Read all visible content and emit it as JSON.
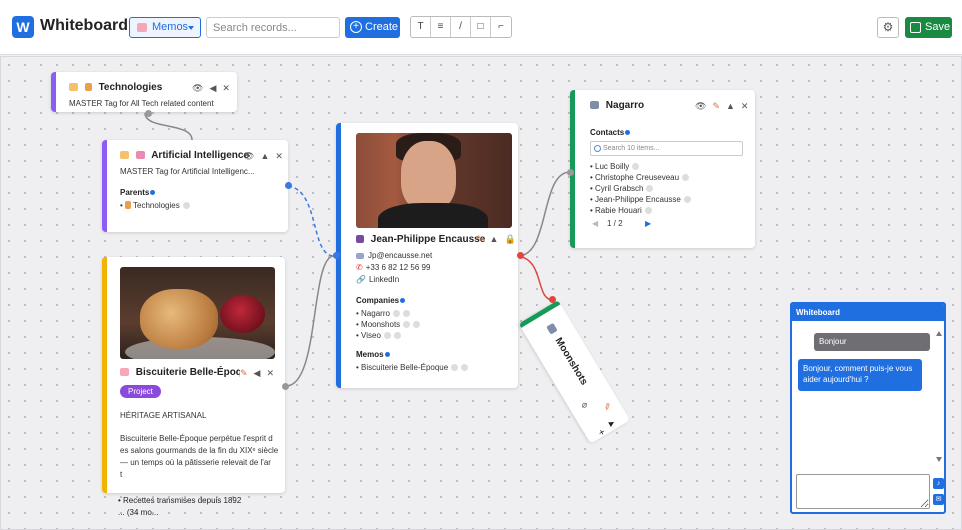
{
  "app": {
    "logo_letter": "W",
    "title": "Whiteboard"
  },
  "toolbar": {
    "memos_select": "Memos",
    "search_placeholder": "Search records...",
    "create_label": "Create",
    "tools": [
      "T",
      "≡",
      "/",
      "□",
      "⌐"
    ],
    "save_label": "Save"
  },
  "cards": {
    "technologies": {
      "title": "Technologies",
      "description": "MASTER Tag for All Tech related content",
      "color": "#8b5cf6"
    },
    "ai": {
      "title": "Artificial Intelligence",
      "description": "MASTER Tag for Artificial Intelligenc...",
      "parents_label": "Parents",
      "parents": [
        "Technologies"
      ],
      "color": "#8b5cf6"
    },
    "person": {
      "name": "Jean-Philippe Encausse",
      "email": "Jp@encausse.net",
      "phone": "+33 6 82 12 56 99",
      "linkedin": "LinkedIn",
      "companies_label": "Companies",
      "companies": [
        "Nagarro",
        "Moonshots",
        "Viseo"
      ],
      "memos_label": "Memos",
      "memos": [
        "Biscuiterie Belle-Époque"
      ],
      "color": "#1f6fe0"
    },
    "biscuiterie": {
      "title": "Biscuiterie Belle-Époque",
      "badge": "Project",
      "subtitle": "HÉRITAGE ARTISANAL",
      "body": [
        "Biscuiterie Belle-Époque perpétue l'esprit d",
        "es salons gourmands de la fin du XIXᵉ siècle",
        " — un temps où la pâtisserie relevait de l'ar",
        "t"
      ],
      "bullet": "• Recettes transmises depuis 1892",
      "more": "... (34 mo...",
      "color": "#f0b400"
    },
    "nagarro": {
      "title": "Nagarro",
      "contacts_label": "Contacts",
      "search_placeholder": "Search 10 items...",
      "contacts": [
        "Luc Boilly",
        "Christophe  Creuseveau",
        "Cyril Grabsch",
        "Jean-Philippe Encausse",
        "Rabie Houari"
      ],
      "pagination": "1 / 2",
      "color": "#159a58"
    },
    "moonshots": {
      "title": "Moonshots",
      "color": "#159a58"
    }
  },
  "chat": {
    "title": "Whiteboard",
    "user_message": "Bonjour",
    "bot_message": "Bonjour, comment puis-je vous aider aujourd'hui ?"
  },
  "icons": {
    "tag": "tag-icon",
    "pencil": "pencil-icon",
    "eye": "eye-icon",
    "play": "play-icon",
    "close": "close-icon",
    "lock": "lock-icon",
    "building": "building-icon",
    "person": "person-icon"
  }
}
